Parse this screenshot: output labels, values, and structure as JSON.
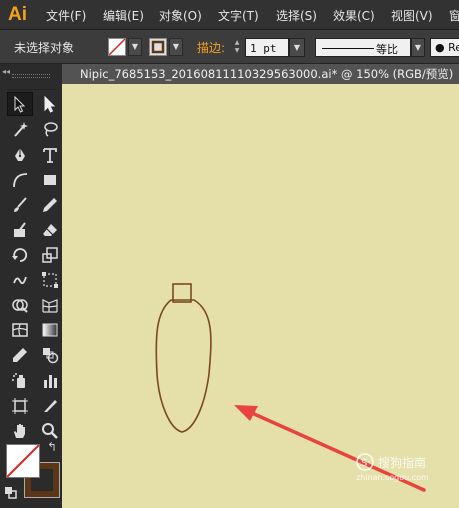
{
  "app": {
    "logo": "Ai"
  },
  "menu": [
    "文件(F)",
    "编辑(E)",
    "对象(O)",
    "文字(T)",
    "选择(S)",
    "效果(C)",
    "视图(V)",
    "窗"
  ],
  "control": {
    "selection_label": "未选择对象",
    "stroke_label": "描边:",
    "stroke_value": "1 pt",
    "profile_label": "等比",
    "brush_label": "● Re"
  },
  "document": {
    "tab_title": "Nipic_7685153_20160811110329563000.ai* @ 150% (RGB/预览)"
  },
  "colors": {
    "canvas": "#e5dfa9",
    "path_stroke": "#7a4a1e",
    "arrow": "#e8443f",
    "stroke_swatch": "#5b3717"
  },
  "tools": [
    [
      "selection-tool",
      "direct-selection-tool"
    ],
    [
      "magic-wand-tool",
      "lasso-tool"
    ],
    [
      "pen-tool",
      "type-tool"
    ],
    [
      "line-segment-tool",
      "rectangle-tool"
    ],
    [
      "paintbrush-tool",
      "pencil-tool"
    ],
    [
      "blob-brush-tool",
      "eraser-tool"
    ],
    [
      "rotate-tool",
      "scale-tool"
    ],
    [
      "warp-tool",
      "free-transform-tool"
    ],
    [
      "shape-builder-tool",
      "perspective-grid-tool"
    ],
    [
      "mesh-tool",
      "gradient-tool"
    ],
    [
      "eyedropper-tool",
      "blend-tool"
    ],
    [
      "symbol-sprayer-tool",
      "column-graph-tool"
    ],
    [
      "artboard-tool",
      "slice-tool"
    ],
    [
      "hand-tool",
      "zoom-tool"
    ]
  ],
  "watermark": {
    "text": "搜狗指南",
    "sub": "zhinan.sogou.com"
  }
}
